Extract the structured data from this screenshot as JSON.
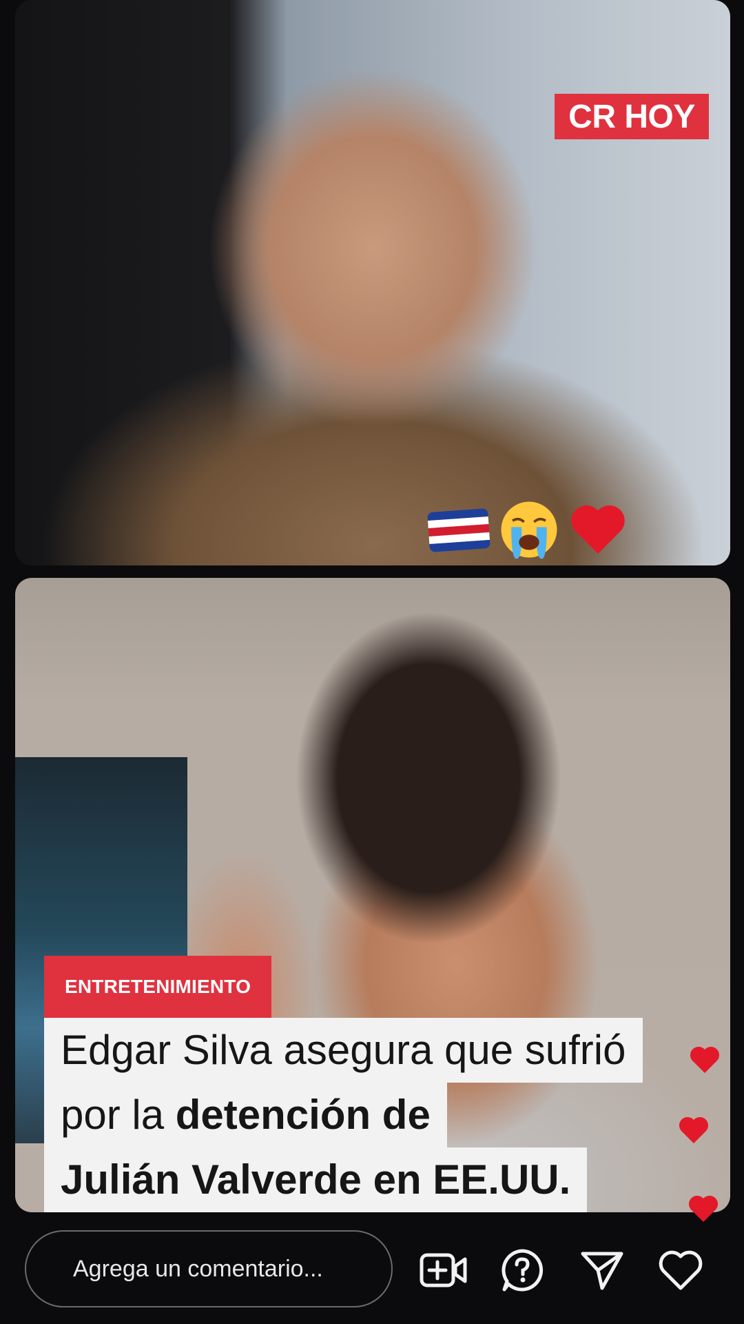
{
  "brand": {
    "label": "CR HOY",
    "color": "#e0313f"
  },
  "reactions": [
    "flag-costa-rica-icon",
    "crying-face-icon",
    "red-heart-icon"
  ],
  "story": {
    "category": "ENTRETENIMIENTO",
    "headline": {
      "line1": "Edgar Silva asegura que sufrió",
      "line2_regular": "por la ",
      "line2_bold": "detención de",
      "line3": "Julián Valverde en EE.UU."
    }
  },
  "comment_bar": {
    "placeholder": "Agrega un comentario...",
    "actions": [
      "add-video-icon",
      "question-icon",
      "send-icon",
      "heart-icon"
    ]
  }
}
